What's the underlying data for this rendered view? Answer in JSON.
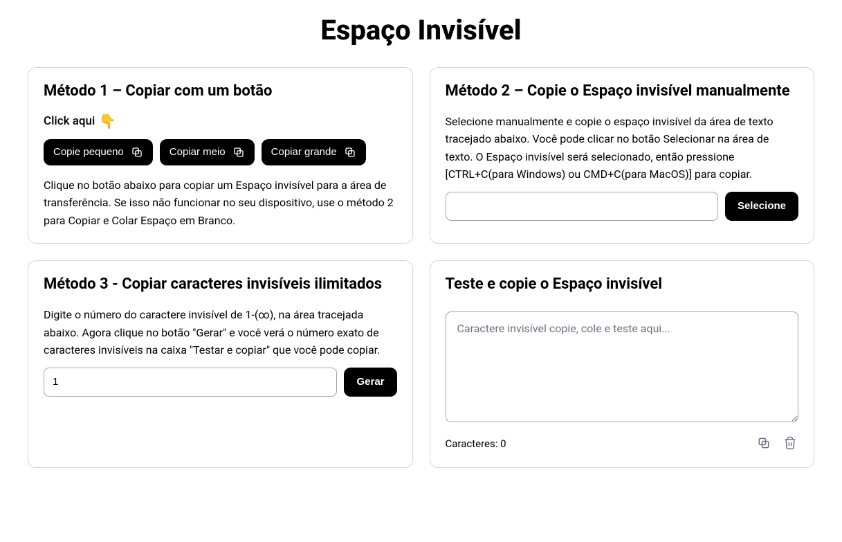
{
  "pageTitle": "Espaço Invisível",
  "method1": {
    "title": "Método 1 – Copiar com um botão",
    "clickHere": "Click aqui",
    "emoji": "👇",
    "btnSmall": "Copie pequeno",
    "btnMedium": "Copiar meio",
    "btnLarge": "Copiar grande",
    "description": "Clique no botão abaixo para copiar um Espaço invisível para a área de transferência. Se isso não funcionar no seu dispositivo, use o método 2 para Copiar e Colar Espaço em Branco."
  },
  "method2": {
    "title": "Método 2 – Copie o Espaço invisível manualmente",
    "description": "Selecione manualmente e copie o espaço invisível da área de texto tracejado abaixo. Você pode clicar no botão Selecionar na área de texto. O Espaço invisível será selecionado, então pressione [CTRL+C(para Windows) ou CMD+C(para MacOS)] para copiar.",
    "btnSelect": "Selecione",
    "inputValue": ""
  },
  "method3": {
    "title": "Método 3 - Copiar caracteres invisíveis ilimitados",
    "description": "Digite o número do caractere invisível de 1-(∞), na área tracejada abaixo. Agora clique no botão \"Gerar\" e você verá o número exato de caracteres invisíveis na caixa \"Testar e copiar\" que você pode copiar.",
    "inputValue": "1",
    "btnGenerate": "Gerar"
  },
  "test": {
    "title": "Teste e copie o Espaço invisível",
    "placeholder": "Caractere invisível copie, cole e teste aqui...",
    "charCountLabel": "Caracteres: 0"
  }
}
